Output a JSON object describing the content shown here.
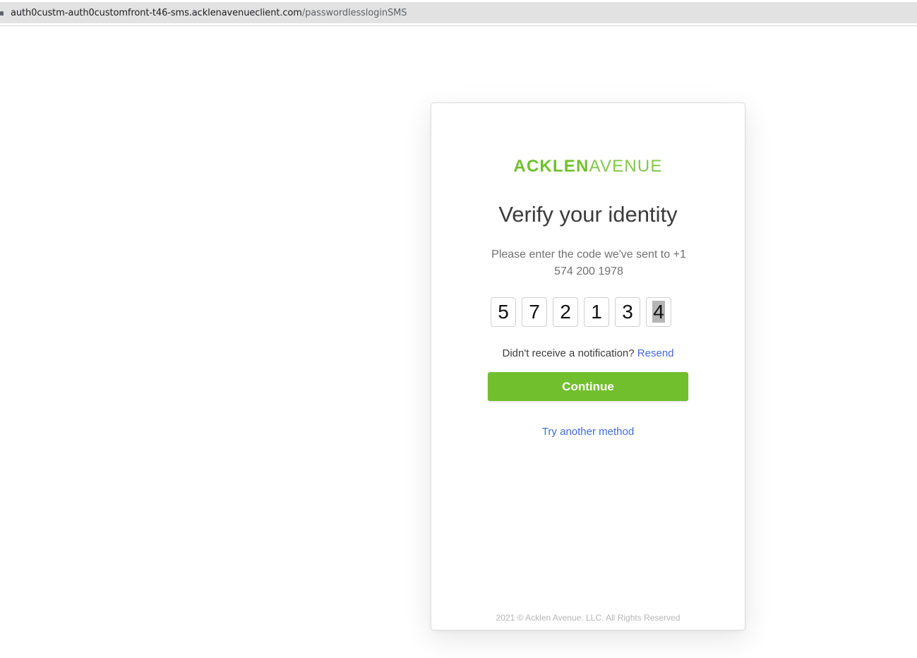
{
  "browser": {
    "url_host": "auth0custm-auth0customfront-t46-sms.acklenavenueclient.com",
    "url_path": "/passwordlessloginSMS"
  },
  "card": {
    "logo_bold": "ACKLEN",
    "logo_light": "AVENUE",
    "title": "Verify your identity",
    "subtitle_line1": "Please enter the code we've sent to +1",
    "subtitle_line2": "574 200 1978",
    "code_digits": [
      "5",
      "7",
      "2",
      "1",
      "3",
      "4"
    ],
    "notice_text": "Didn't receive a notification?",
    "resend_label": "Resend",
    "continue_label": "Continue",
    "try_another_label": "Try another method",
    "footer": "2021 © Acklen Avenue. LLC. All Rights Reserved"
  },
  "colors": {
    "brand_green": "#72bf2e",
    "link_blue": "#3f6bd6"
  }
}
